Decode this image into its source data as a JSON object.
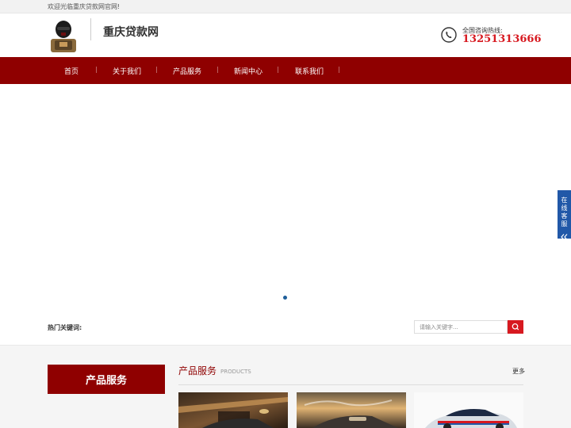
{
  "topbar": {
    "welcome": "欢迎光临重庆贷款网官网!"
  },
  "header": {
    "site_title": "重庆贷款网",
    "hotline_label": "全国咨询热线:",
    "hotline_number": "13251313666"
  },
  "nav": {
    "items": [
      {
        "label": "首页"
      },
      {
        "label": "关于我们"
      },
      {
        "label": "产品服务"
      },
      {
        "label": "新闻中心"
      },
      {
        "label": "联系我们"
      }
    ]
  },
  "search": {
    "hot_keywords_label": "热门关键词:",
    "placeholder": "请输入关键字..."
  },
  "sidebar": {
    "title": "产品服务"
  },
  "products_section": {
    "title": "产品服务",
    "subtitle": "PRODUCTS",
    "more": "更多"
  },
  "chat_tab": {
    "label": "在线客服"
  },
  "colors": {
    "brand_red": "#8f0000",
    "accent_red": "#d71920",
    "chat_blue": "#2158a8"
  }
}
